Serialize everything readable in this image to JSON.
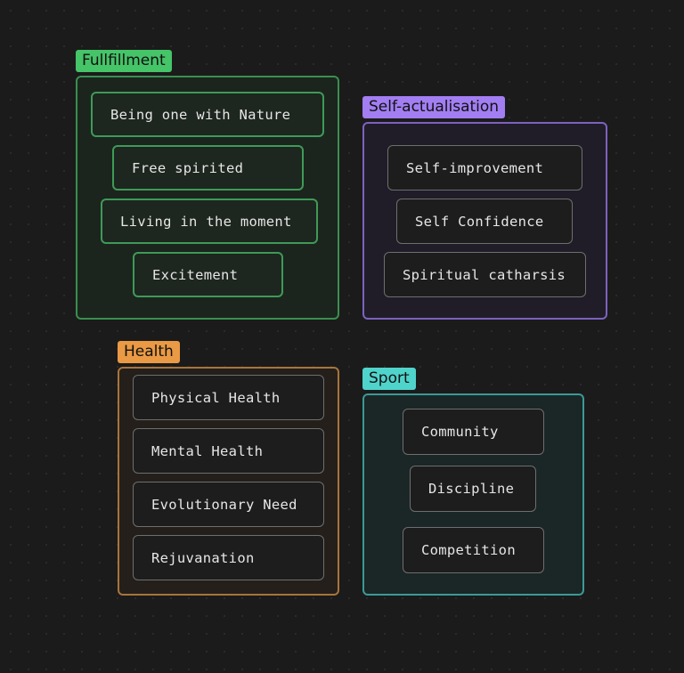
{
  "groups": {
    "fulfillment": {
      "title": "Fullfillment",
      "color": "#45c468",
      "items": [
        "Being one with Nature",
        "Free spirited",
        "Living in the moment",
        "Excitement"
      ]
    },
    "self_actualisation": {
      "title": "Self-actualisation",
      "color": "#a27ef2",
      "items": [
        "Self-improvement",
        "Self Confidence",
        "Spiritual catharsis"
      ]
    },
    "health": {
      "title": "Health",
      "color": "#ea9a44",
      "items": [
        "Physical Health",
        "Mental Health",
        "Evolutionary Need",
        "Rejuvanation"
      ]
    },
    "sport": {
      "title": "Sport",
      "color": "#4fd4cc",
      "items": [
        "Community",
        "Discipline",
        "Competition"
      ]
    }
  }
}
